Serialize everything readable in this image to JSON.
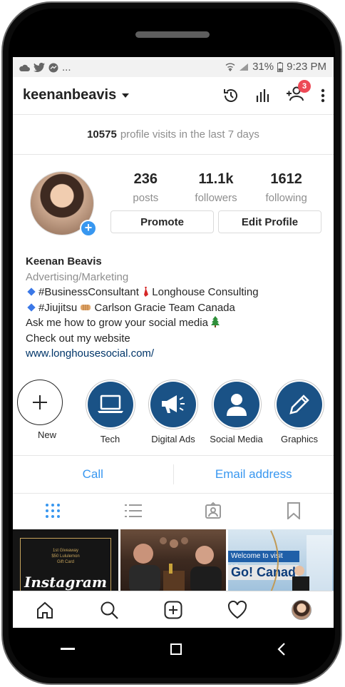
{
  "status_bar": {
    "left_icons": [
      "cloud-icon",
      "twitter-icon",
      "messenger-icon"
    ],
    "ellipsis": "...",
    "battery": "31%",
    "time": "9:23 PM"
  },
  "header": {
    "username": "keenanbeavis",
    "notification_count": "3"
  },
  "visits": {
    "count": "10575",
    "text": "profile visits in the last 7 days"
  },
  "stats": [
    {
      "value": "236",
      "label": "posts"
    },
    {
      "value": "11.1k",
      "label": "followers"
    },
    {
      "value": "1612",
      "label": "following"
    }
  ],
  "buttons": {
    "promote": "Promote",
    "edit_profile": "Edit Profile"
  },
  "bio": {
    "name": "Keenan Beavis",
    "category": "Advertising/Marketing",
    "line1": "#BusinessConsultant",
    "line1_rest": "Longhouse Consulting",
    "line2": "#Jiujitsu",
    "line2_rest": "Carlson Gracie Team Canada",
    "line3": "Ask me how to grow your social media",
    "line4": "Check out my website",
    "website": "www.longhousesocial.com/"
  },
  "highlights": [
    {
      "label": "New",
      "icon": "plus-icon"
    },
    {
      "label": "Tech",
      "icon": "laptop-icon"
    },
    {
      "label": "Digital Ads",
      "icon": "megaphone-icon"
    },
    {
      "label": "Social Media",
      "icon": "person-icon"
    },
    {
      "label": "Graphics",
      "icon": "pencil-icon"
    }
  ],
  "contact": {
    "call": "Call",
    "email": "Email address"
  },
  "posts": {
    "post1_small": "1st Giveaway\n$50 Lululemon\nGift Card",
    "post1_script": "Instagram",
    "post3_banner": "Welcome to visit Ulsan",
    "post3_text": "Go! Canad"
  },
  "colors": {
    "accent": "#3897f0",
    "badge": "#ed4956",
    "highlight_bg": "#1a5286",
    "link": "#003569"
  }
}
